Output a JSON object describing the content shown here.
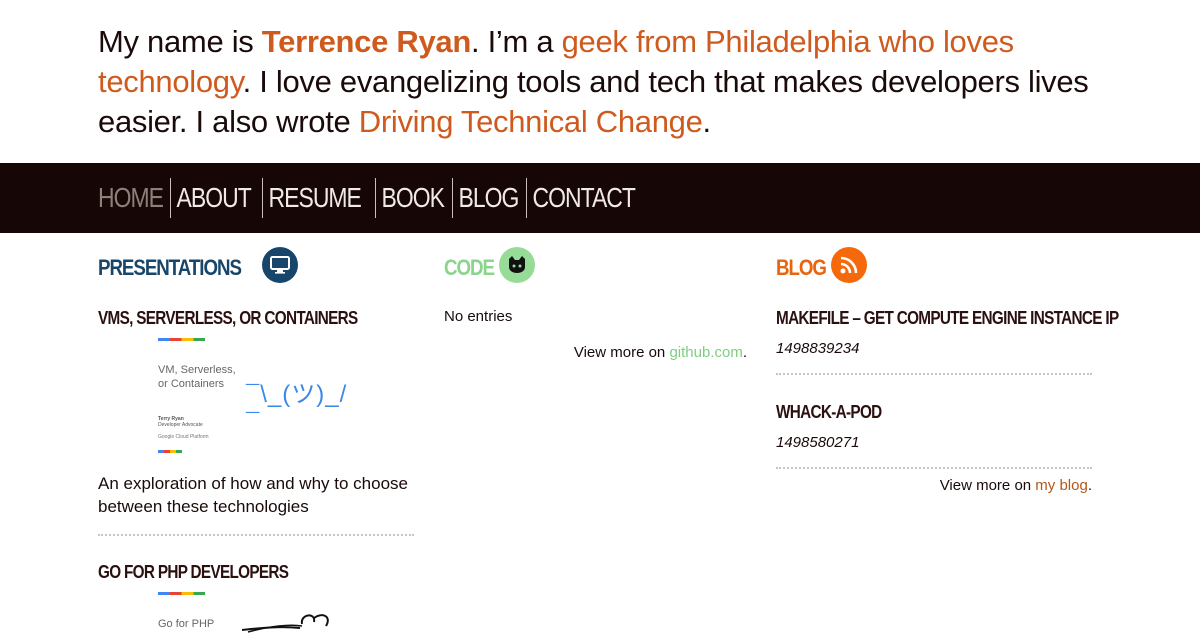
{
  "intro": {
    "t1": "My name is ",
    "name": "Terrence Ryan",
    "t2": ". I’m a ",
    "link1": "geek from Philadelphia who loves technology",
    "t3": ". I love evangelizing tools and tech that makes developers lives easier. I also wrote ",
    "link2": "Driving Technical Change",
    "t4": "."
  },
  "nav": [
    "Home",
    "About",
    "Resume",
    "Book",
    "Blog",
    "Contact"
  ],
  "colors": {
    "accent": "#cf5a1e",
    "nav_bg": "#160606",
    "presentations": "#18466b",
    "code": "#8ad48c",
    "blog": "#e8640d"
  },
  "presentations": {
    "heading": "Presentations",
    "icon": "monitor-icon",
    "items": [
      {
        "title": "VMs, Serverless, or Containers",
        "thumb_title": "VM, Serverless, or Containers",
        "thumb_art": "¯\\_(ツ)_/¯",
        "thumb_author": "Terry Ryan",
        "thumb_role": "Developer Advocate",
        "thumb_brand": "Google Cloud Platform",
        "description": "An exploration of how and why to choose between these technologies"
      },
      {
        "title": "Go for PHP Developers",
        "thumb_title": "Go for PHP",
        "thumb_art": "GO"
      }
    ]
  },
  "code": {
    "heading": "Code",
    "icon": "github-icon",
    "empty": "No entries",
    "more_prefix": "View more on ",
    "more_link": "github.com",
    "more_suffix": "."
  },
  "blog": {
    "heading": "Blog",
    "icon": "rss-icon",
    "posts": [
      {
        "title": "Makefile – Get Compute Engine instance IP",
        "date": "1498839234"
      },
      {
        "title": "Whack-a-pod",
        "date": "1498580271"
      }
    ],
    "more_prefix": "View more on ",
    "more_link": "my blog",
    "more_suffix": "."
  }
}
